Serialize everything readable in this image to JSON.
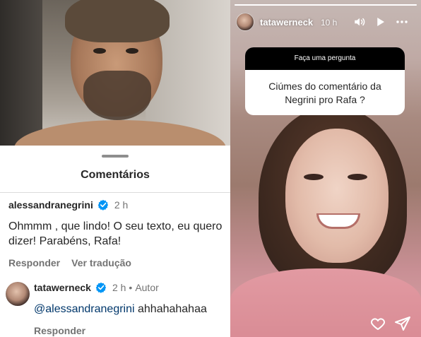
{
  "comments_sheet": {
    "title": "Comentários",
    "comments": [
      {
        "username": "alessandranegrini",
        "time": "2 h",
        "text": "Ohmmm , que lindo! O seu texto, eu quero dizer! Parabéns, Rafa!",
        "actions": [
          "Responder",
          "Ver tradução"
        ]
      },
      {
        "username": "tatawerneck",
        "time": "2 h",
        "separator": "•",
        "badge": "Autor",
        "mention": "@alessandranegrini",
        "text": " ahhahahahaa",
        "actions": [
          "Responder"
        ]
      }
    ]
  },
  "story": {
    "username": "tatawerneck",
    "time": "10 h",
    "question_header": "Faça uma pergunta",
    "question_text": "Ciúmes do comentário da Negrini pro Rafa ?",
    "controls": [
      "volume-icon",
      "play-icon",
      "more-icon"
    ],
    "footer_icons": [
      "heart-icon",
      "send-icon"
    ]
  },
  "colors": {
    "verified": "#0095f6",
    "text_primary": "#262626",
    "text_secondary": "#737373",
    "mention": "#00376b"
  }
}
